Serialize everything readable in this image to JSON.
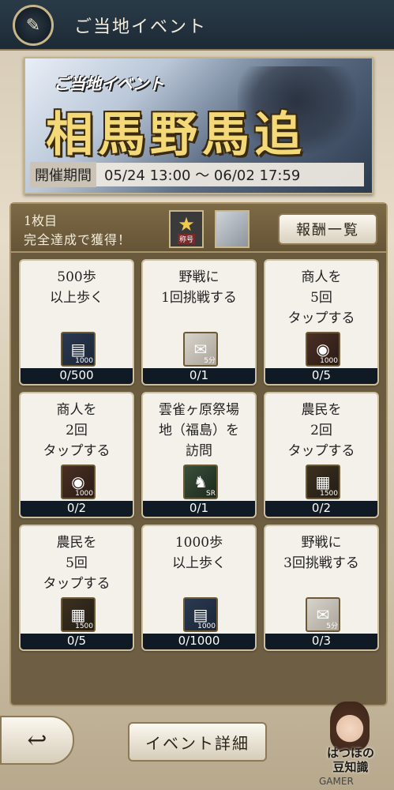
{
  "header": {
    "title": "ご当地イベント",
    "icon": "crossed-brushes-icon"
  },
  "banner": {
    "subtitle": "ご当地イベント",
    "title": "相馬野馬追",
    "period_label": "開催期間",
    "period_value": "05/24 13:00 ～ 06/02 17:59"
  },
  "panel": {
    "sheet": "1枚目",
    "reward_text": "完全達成で獲得！",
    "badge_tag": "称号",
    "reward_list_label": "報酬一覧"
  },
  "missions": [
    {
      "text": "500歩\n以上歩く",
      "icon": "silver-icon",
      "qty": "1000",
      "progress": "0/500"
    },
    {
      "text": "野戦に\n1回挑戦する",
      "icon": "scroll-icon",
      "qty": "5分",
      "progress": "0/1"
    },
    {
      "text": "商人を\n5回\nタップする",
      "icon": "coin-icon",
      "qty": "1000",
      "progress": "0/5"
    },
    {
      "text": "商人を\n2回\nタップする",
      "icon": "coin-icon",
      "qty": "1000",
      "progress": "0/2"
    },
    {
      "text": "雲雀ヶ原祭場\n地（福島）を\n訪問",
      "icon": "horse-icon",
      "qty": "SR",
      "progress": "0/1"
    },
    {
      "text": "農民を\n2回\nタップする",
      "icon": "rice-icon",
      "qty": "1500",
      "progress": "0/2"
    },
    {
      "text": "農民を\n5回\nタップする",
      "icon": "rice-icon",
      "qty": "1500",
      "progress": "0/5"
    },
    {
      "text": "1000歩\n以上歩く",
      "icon": "silver-icon",
      "qty": "1000",
      "progress": "0/1000"
    },
    {
      "text": "野戦に\n3回挑戦する",
      "icon": "scroll-icon",
      "qty": "5分",
      "progress": "0/3"
    }
  ],
  "footer": {
    "event_detail_label": "イベント詳細",
    "guide_label": "はつほの\n豆知識",
    "watermark": "GAMER"
  }
}
